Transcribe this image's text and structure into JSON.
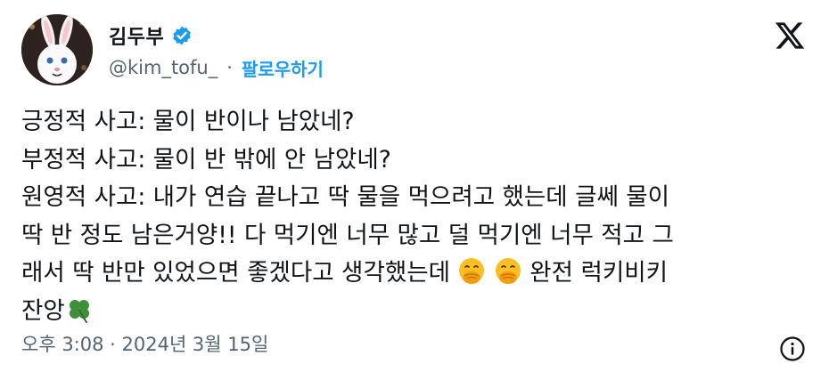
{
  "author": {
    "name": "김두부",
    "handle": "@kim_tofu_",
    "separator": "·",
    "follow_label": "팔로우하기",
    "verified_icon": "verified-badge-icon",
    "avatar_icon": "white-rabbit-avatar"
  },
  "tweet": {
    "line_1": "긍정적 사고: 물이 반이나 남았네?",
    "line_2": "부정적 사고: 물이 반 밖에 안 남았네?",
    "line_3": "원영적 사고: 내가 연습 끝나고 딱 물을 먹으려고 했는데 글쎄 물이",
    "line_4": "딱 반 정도 남은거양!! 다 먹기엔 너무 많고 덜 먹기엔 너무 적고 그",
    "line_5a": "래서 딱 반만 있었으면 좋겠다고 생각했는데",
    "line_5b": " 완전 럭키비키",
    "line_6": "잔앙",
    "emojis": [
      "face-with-hand-over-mouth-icon",
      "face-with-hand-over-mouth-icon",
      "four-leaf-clover-icon"
    ]
  },
  "timestamp": "오후 3:08 · 2024년 3월 15일",
  "colors": {
    "accent": "#1d9bf0",
    "secondary_text": "#536471",
    "primary_text": "#0f1419"
  },
  "icons": {
    "platform": "x-logo-icon",
    "info": "info-icon"
  }
}
